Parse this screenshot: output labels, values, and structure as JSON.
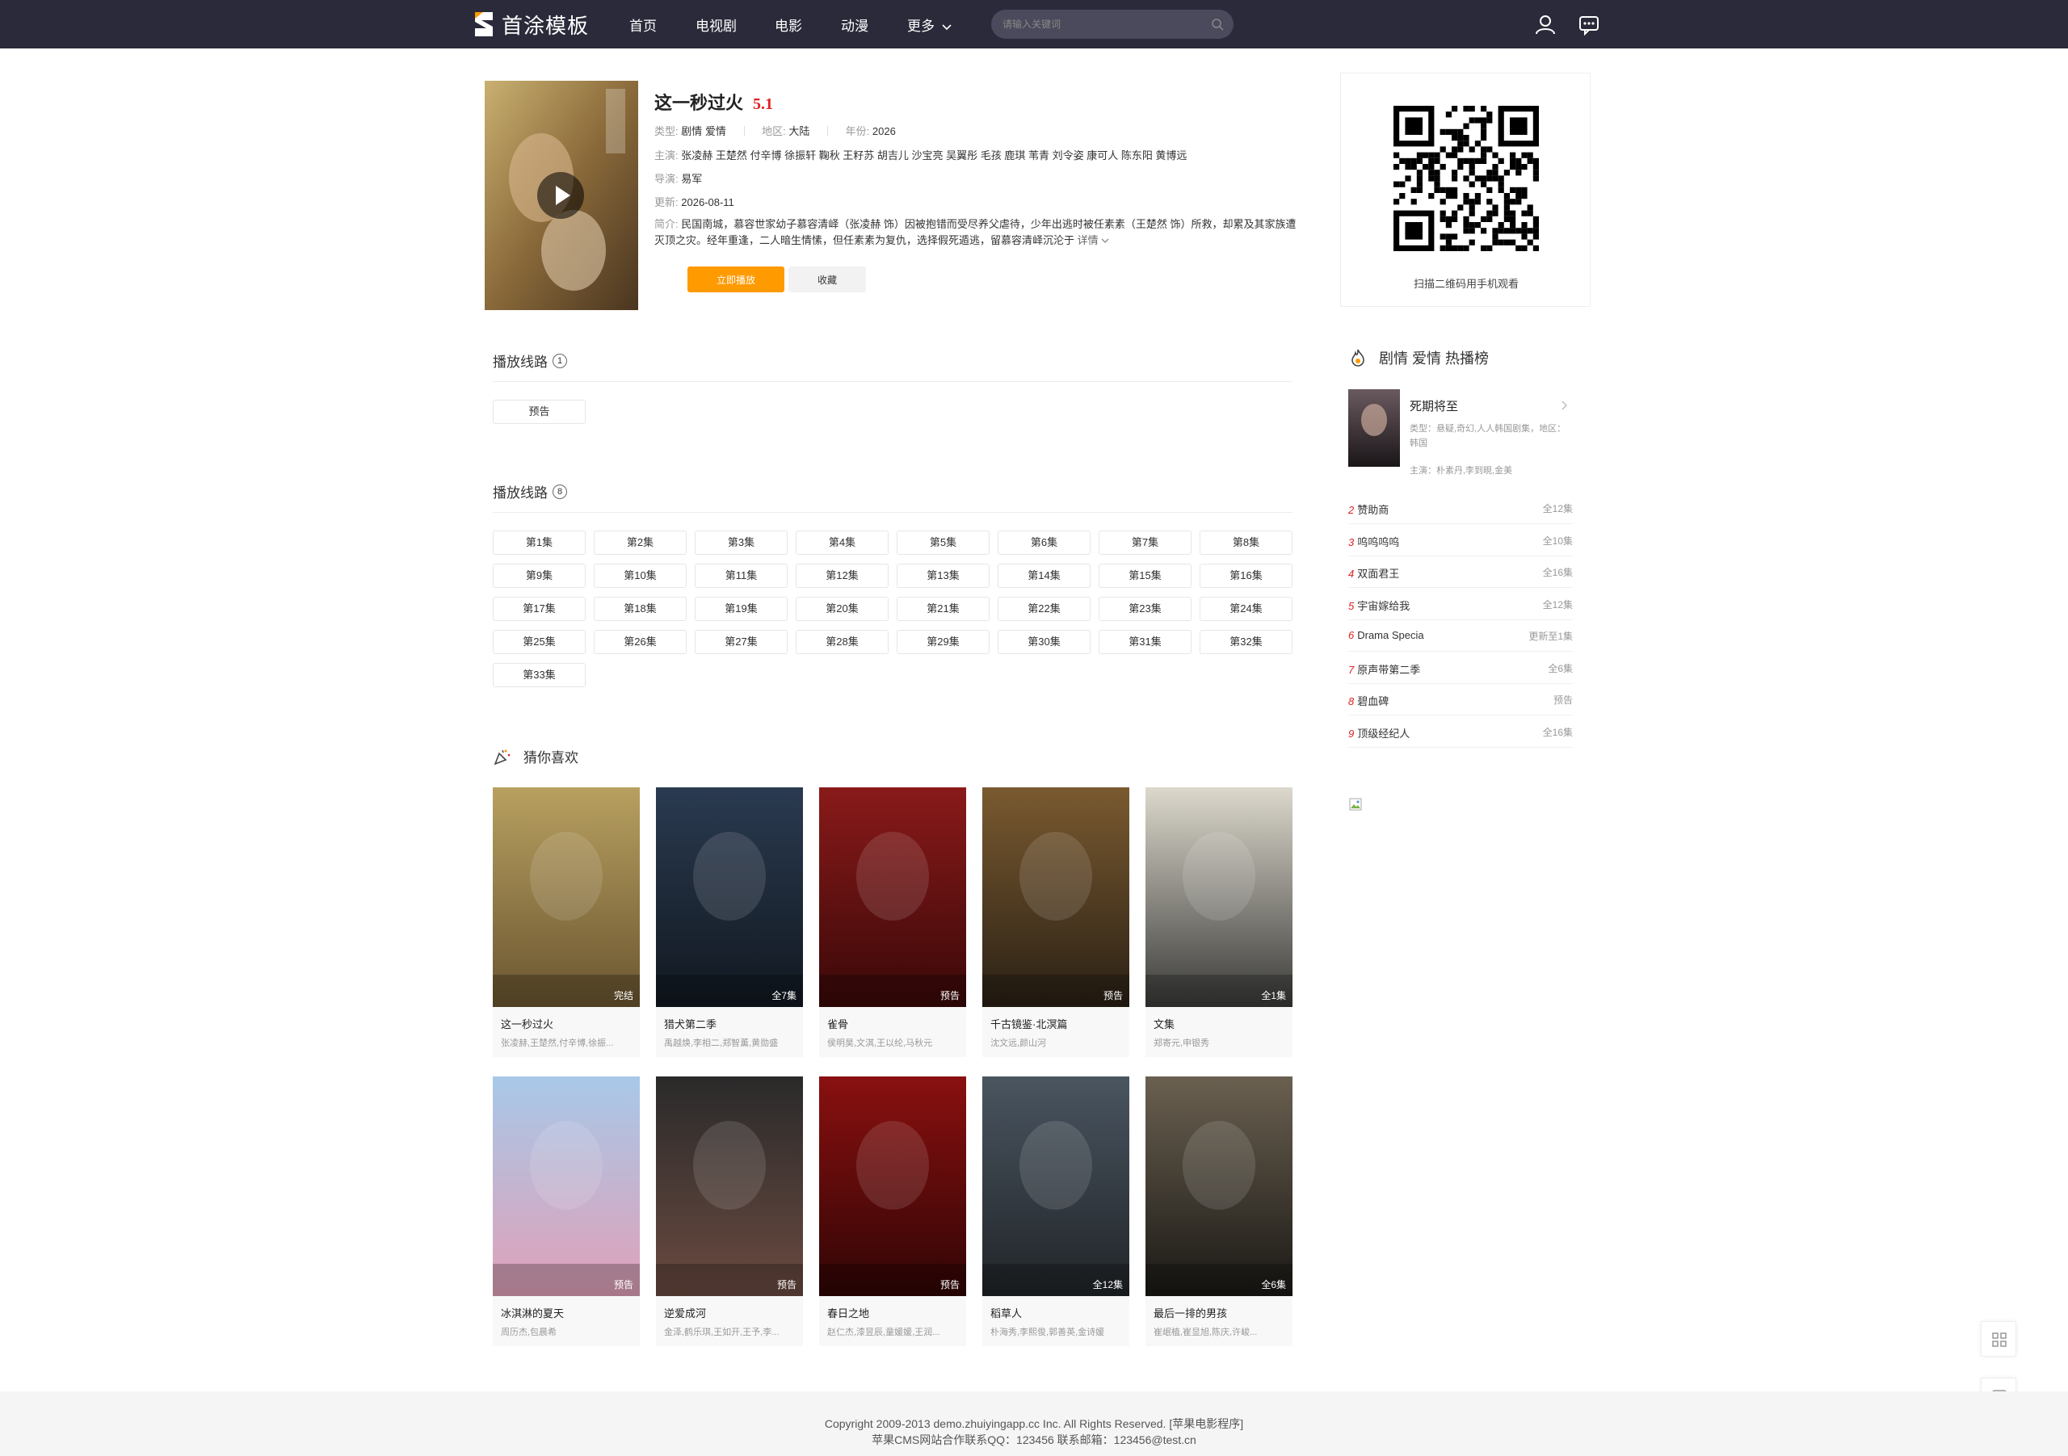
{
  "header": {
    "logo_text": "首涂模板",
    "nav": [
      "首页",
      "电视剧",
      "电影",
      "动漫",
      "更多"
    ],
    "search_placeholder": "请输入关键词"
  },
  "detail": {
    "title": "这一秒过火",
    "score": "5.1",
    "type_label": "类型:",
    "type_value": "剧情 爱情",
    "area_label": "地区:",
    "area_value": "大陆",
    "year_label": "年份:",
    "year_value": "2026",
    "cast_label": "主演:",
    "cast_value": "张凌赫 王楚然 付辛博 徐振轩 鞠秋 王籽苏 胡吉儿 沙宝亮 吴翼彤 毛孩 鹿琪 苇青 刘令姿 康可人 陈东阳 黄博远",
    "director_label": "导演:",
    "director_value": "易军",
    "update_label": "更新:",
    "update_value": "2026-08-11",
    "intro_label": "简介:",
    "intro_value": "民国南城，慕容世家幼子慕容清峄（张凌赫 饰）因被抱错而受尽养父虐待，少年出逃时被任素素（王楚然 饰）所救，却累及其家族遭灭顶之灾。经年重逢，二人暗生情愫，但任素素为复仇，选择假死遁逃，留慕容清峄沉沦于",
    "intro_more": "详情",
    "play_button": "立即播放",
    "fav_button": "收藏"
  },
  "qr": {
    "caption": "扫描二维码用手机观看"
  },
  "playlists": [
    {
      "title": "播放线路",
      "num": "1",
      "episodes": [
        "预告"
      ]
    },
    {
      "title": "播放线路",
      "num": "8",
      "episodes": [
        "第1集",
        "第2集",
        "第3集",
        "第4集",
        "第5集",
        "第6集",
        "第7集",
        "第8集",
        "第9集",
        "第10集",
        "第11集",
        "第12集",
        "第13集",
        "第14集",
        "第15集",
        "第16集",
        "第17集",
        "第18集",
        "第19集",
        "第20集",
        "第21集",
        "第22集",
        "第23集",
        "第24集",
        "第25集",
        "第26集",
        "第27集",
        "第28集",
        "第29集",
        "第30集",
        "第31集",
        "第32集",
        "第33集"
      ]
    }
  ],
  "guess": {
    "title": "猜你喜欢",
    "items": [
      {
        "title": "这一秒过火",
        "cast": "张凌赫,王楚然,付辛博,徐振...",
        "badge": "完结",
        "colors": [
          "#b8a060",
          "#6a5530"
        ]
      },
      {
        "title": "猎犬第二季",
        "cast": "禹越焕,李相二,郑智薰,黄勋盛",
        "badge": "全7集",
        "colors": [
          "#2a3a50",
          "#111820"
        ]
      },
      {
        "title": "雀骨",
        "cast": "侯明昊,文淇,王以纶,马秋元",
        "badge": "预告",
        "colors": [
          "#8a1a1a",
          "#3a0808"
        ]
      },
      {
        "title": "千古镜鉴·北溟篇",
        "cast": "沈文远,颜山河",
        "badge": "预告",
        "colors": [
          "#7a5a30",
          "#2a2015"
        ]
      },
      {
        "title": "文集",
        "cast": "郑寄元,申银秀",
        "badge": "全1集",
        "colors": [
          "#dcd8cc",
          "#3a3a38"
        ]
      },
      {
        "title": "冰淇淋的夏天",
        "cast": "周历杰,包晨希",
        "badge": "预告",
        "colors": [
          "#a8c8e8",
          "#e0a0b8"
        ]
      },
      {
        "title": "逆爱成河",
        "cast": "金泽,鹤乐琪,王如开,王予,李...",
        "badge": "预告",
        "colors": [
          "#2a2a2a",
          "#6a4a40"
        ]
      },
      {
        "title": "春日之地",
        "cast": "赵仁杰,漆昱辰,童媛媛,王润...",
        "badge": "预告",
        "colors": [
          "#8a1010",
          "#300505"
        ]
      },
      {
        "title": "稻草人",
        "cast": "朴海秀,李熙俊,郭善英,金诗媛",
        "badge": "全12集",
        "colors": [
          "#4a5560",
          "#202428"
        ]
      },
      {
        "title": "最后一排的男孩",
        "cast": "崔岷植,崔显旭,陈庆,许峻...",
        "badge": "全6集",
        "colors": [
          "#6a6050",
          "#1a1815"
        ]
      }
    ]
  },
  "hot": {
    "title": "剧情 爱情 热播榜",
    "top": {
      "name": "死期将至",
      "type": "类型：悬疑,奇幻,人人韩国剧集，地区：韩国",
      "cast": "主演：朴素丹,李到晛,金美"
    },
    "rows": [
      {
        "rank": "2",
        "name": "赞助商",
        "status": "全12集"
      },
      {
        "rank": "3",
        "name": "呜呜呜呜",
        "status": "全10集"
      },
      {
        "rank": "4",
        "name": "双面君王",
        "status": "全16集"
      },
      {
        "rank": "5",
        "name": "宇宙嫁给我",
        "status": "全12集"
      },
      {
        "rank": "6",
        "name": "Drama Specia",
        "status": "更新至1集"
      },
      {
        "rank": "7",
        "name": "原声带第二季",
        "status": "全6集"
      },
      {
        "rank": "8",
        "name": "碧血碑",
        "status": "预告"
      },
      {
        "rank": "9",
        "name": "顶级经纪人",
        "status": "全16集"
      }
    ]
  },
  "footer": {
    "line1": "Copyright 2009-2013 demo.zhuiyingapp.cc Inc. All Rights Reserved. [苹果电影程序]",
    "line2": "苹果CMS网站合作联系QQ：123456 联系邮箱：123456@test.cn"
  },
  "colors": {
    "header_bg": "#2a2a3a",
    "accent_orange": "#ff9a00",
    "rank_red": "#e02020"
  }
}
